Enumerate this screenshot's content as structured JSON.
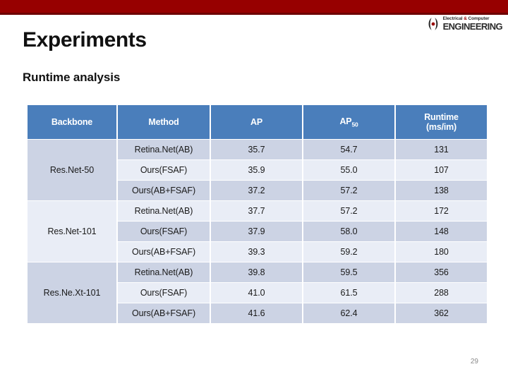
{
  "top_bar": {
    "color": "#970000",
    "edge_color": "#6d0000"
  },
  "logo": {
    "icon": "ece-bracket-icon",
    "line1_pre": "Electrical ",
    "line1_amp": "&",
    "line1_post": " Computer",
    "line2": "ENGINEERING"
  },
  "slide": {
    "title": "Experiments",
    "subtitle": "Runtime analysis",
    "page_number": "29"
  },
  "table": {
    "header_color": "#4a7ebb",
    "row_dark_color": "#ccd3e4",
    "row_light_color": "#e9edf6",
    "headers": {
      "backbone": "Backbone",
      "method": "Method",
      "ap": "AP",
      "ap50_base": "AP",
      "ap50_sub": "50",
      "runtime_line1": "Runtime",
      "runtime_line2": "(ms/im)"
    },
    "groups": [
      {
        "backbone": "Res.Net-50",
        "rows": [
          {
            "method": "Retina.Net(AB)",
            "ap": "35.7",
            "ap50": "54.7",
            "runtime": "131",
            "shade": "dark"
          },
          {
            "method": "Ours(FSAF)",
            "ap": "35.9",
            "ap50": "55.0",
            "runtime": "107",
            "shade": "light"
          },
          {
            "method": "Ours(AB+FSAF)",
            "ap": "37.2",
            "ap50": "57.2",
            "runtime": "138",
            "shade": "dark"
          }
        ],
        "backbone_shade": "dark"
      },
      {
        "backbone": "Res.Net-101",
        "rows": [
          {
            "method": "Retina.Net(AB)",
            "ap": "37.7",
            "ap50": "57.2",
            "runtime": "172",
            "shade": "light"
          },
          {
            "method": "Ours(FSAF)",
            "ap": "37.9",
            "ap50": "58.0",
            "runtime": "148",
            "shade": "dark"
          },
          {
            "method": "Ours(AB+FSAF)",
            "ap": "39.3",
            "ap50": "59.2",
            "runtime": "180",
            "shade": "light"
          }
        ],
        "backbone_shade": "light"
      },
      {
        "backbone": "Res.Ne.Xt-101",
        "rows": [
          {
            "method": "Retina.Net(AB)",
            "ap": "39.8",
            "ap50": "59.5",
            "runtime": "356",
            "shade": "dark"
          },
          {
            "method": "Ours(FSAF)",
            "ap": "41.0",
            "ap50": "61.5",
            "runtime": "288",
            "shade": "light"
          },
          {
            "method": "Ours(AB+FSAF)",
            "ap": "41.6",
            "ap50": "62.4",
            "runtime": "362",
            "shade": "dark"
          }
        ],
        "backbone_shade": "dark"
      }
    ]
  }
}
